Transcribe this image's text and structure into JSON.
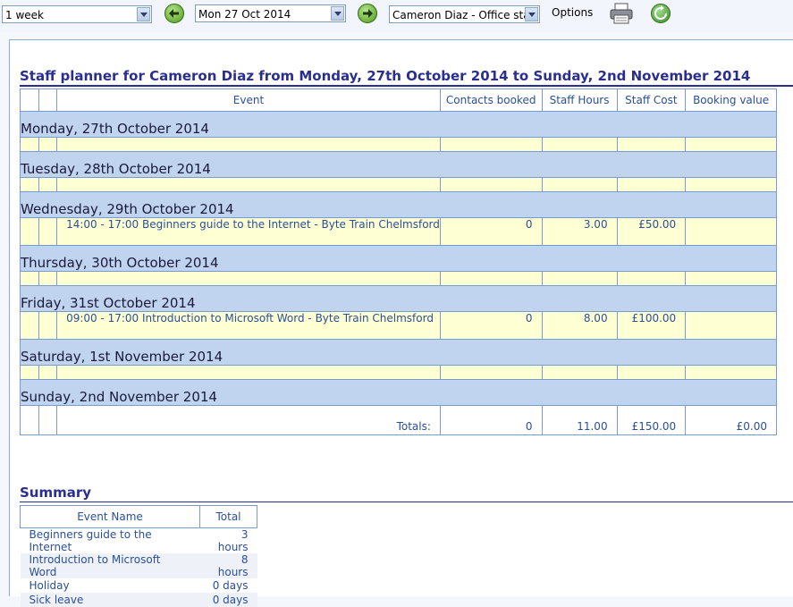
{
  "toolbar": {
    "period": "1 week",
    "date": "Mon 27 Oct 2014",
    "staff": "Cameron Diaz - Office staff",
    "options": "Options"
  },
  "title": "Staff planner for Cameron Diaz from Monday, 27th October 2014 to Sunday, 2nd November 2014",
  "columns": {
    "event": "Event",
    "contacts": "Contacts booked",
    "hours": "Staff Hours",
    "cost": "Staff Cost",
    "value": "Booking value"
  },
  "days": [
    {
      "label": "Monday, 27th October 2014"
    },
    {
      "label": "Tuesday, 28th October 2014"
    },
    {
      "label": "Wednesday, 29th October 2014",
      "event": "14:00 - 17:00 Beginners guide to the Internet - Byte Train Chelmsford",
      "contacts": "0",
      "hours": "3.00",
      "cost": "£50.00",
      "value": ""
    },
    {
      "label": "Thursday, 30th October 2014"
    },
    {
      "label": "Friday, 31st October 2014",
      "event": "09:00 - 17:00 Introduction to Microsoft Word - Byte Train Chelmsford",
      "contacts": "0",
      "hours": "8.00",
      "cost": "£100.00",
      "value": ""
    },
    {
      "label": "Saturday, 1st November 2014"
    },
    {
      "label": "Sunday, 2nd November 2014"
    }
  ],
  "totals": {
    "label": "Totals:",
    "contacts": "0",
    "hours": "11.00",
    "cost": "£150.00",
    "value": "£0.00"
  },
  "summary": {
    "title": "Summary",
    "col_name": "Event Name",
    "col_total": "Total",
    "rows": [
      {
        "name": "Beginners guide to the Internet",
        "total": "3 hours"
      },
      {
        "name": "Introduction to Microsoft Word",
        "total": "8 hours"
      },
      {
        "name": "Holiday",
        "total": "0 days"
      },
      {
        "name": "Sick leave",
        "total": "0 days"
      }
    ]
  }
}
